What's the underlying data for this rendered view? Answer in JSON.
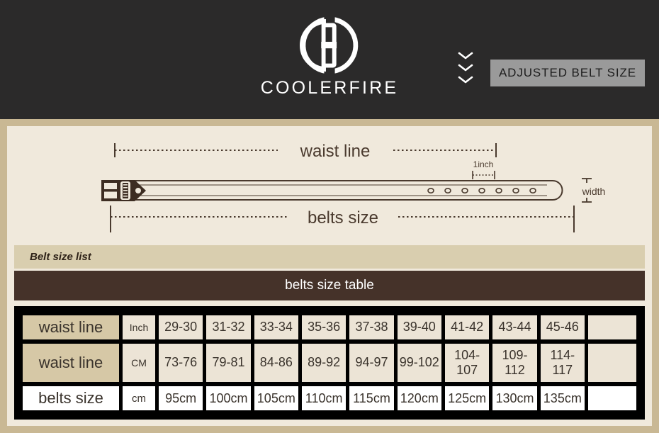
{
  "header": {
    "brand_name": "COOLERFIRE",
    "logo_icon": "coolerfire-cd-monogram-icon",
    "chevron_icon": "chevron-down-icon",
    "chevron_count": 3,
    "badge_label": "ADJUSTED BELT SIZE",
    "background_color": "#2b2a2a",
    "badge_color": "#9a9a9a"
  },
  "diagram": {
    "waist_line_label": "waist line",
    "belts_size_label": "belts size",
    "one_inch_label": "1inch",
    "width_label": "width",
    "hole_count": 7,
    "line_color": "#4a3a2e",
    "panel_color": "#f0e9dc"
  },
  "bars": {
    "belt_size_list": "Belt size list",
    "belts_size_table": "belts size table",
    "list_bar_color": "#d9ceaf",
    "table_bar_color": "#453229"
  },
  "chart_data": {
    "type": "table",
    "title": "belts size table",
    "rows": [
      {
        "label": "waist line",
        "unit": "Inch",
        "values": [
          "29-30",
          "31-32",
          "33-34",
          "35-36",
          "37-38",
          "39-40",
          "41-42",
          "43-44",
          "45-46"
        ],
        "trailing": ""
      },
      {
        "label": "waist line",
        "unit": "CM",
        "values": [
          "73-76",
          "79-81",
          "84-86",
          "89-92",
          "94-97",
          "99-102",
          "104-107",
          "109-112",
          "114-117"
        ],
        "trailing": ""
      },
      {
        "label": "belts size",
        "unit": "cm",
        "values": [
          "95cm",
          "100cm",
          "105cm",
          "110cm",
          "115cm",
          "120cm",
          "125cm",
          "130cm",
          "135cm"
        ],
        "trailing": ""
      }
    ]
  }
}
